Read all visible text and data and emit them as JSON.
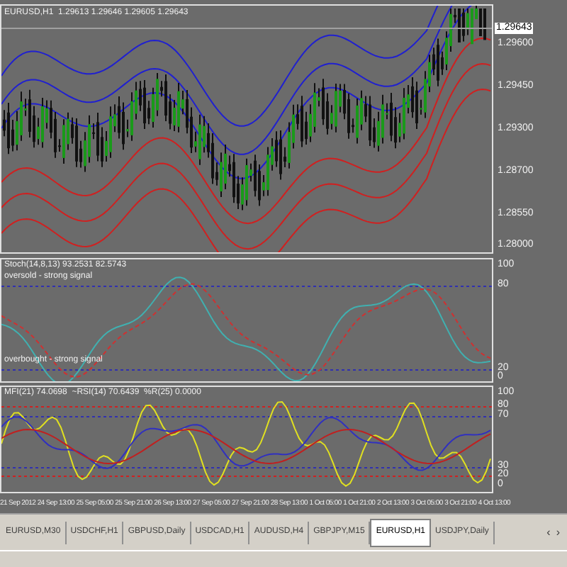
{
  "main_chart": {
    "title": "EURUSD,H1  1.29613 1.29646 1.29605 1.29643",
    "price_tag": "1.29643",
    "price_axis": [
      "1.29600",
      "1.29450",
      "1.29300",
      "1.28700",
      "1.28550",
      "1.28000"
    ]
  },
  "stoch_panel": {
    "title": "Stoch(14,8,13) 93.2531 82.5743",
    "upper_label": "oversold - strong signal",
    "lower_label": "overbought - strong signal",
    "axis": [
      "100",
      "80",
      "20",
      "0"
    ]
  },
  "mfi_panel": {
    "title": "MFI(21) 74.0698  ~RSI(14) 70.6439  %R(25) 0.0000",
    "axis": [
      "100",
      "80",
      "70",
      "30",
      "20",
      "0"
    ]
  },
  "time_axis": [
    "21 Sep 2012",
    "24 Sep 13:00",
    "25 Sep 05:00",
    "25 Sep 21:00",
    "26 Sep 13:00",
    "27 Sep 05:00",
    "27 Sep 21:00",
    "28 Sep 13:00",
    "1 Oct 05:00",
    "1 Oct 21:00",
    "2 Oct 13:00",
    "3 Oct 05:00",
    "3 Oct 21:00",
    "4 Oct 13:00"
  ],
  "tabs": [
    {
      "label": "EURUSD,M30",
      "selected": false
    },
    {
      "label": "USDCHF,H1",
      "selected": false
    },
    {
      "label": "GBPUSD,Daily",
      "selected": false
    },
    {
      "label": "USDCAD,H1",
      "selected": false
    },
    {
      "label": "AUDUSD,H4",
      "selected": false
    },
    {
      "label": "GBPJPY,M15",
      "selected": false
    },
    {
      "label": "EURUSD,H1",
      "selected": true
    },
    {
      "label": "USDJPY,Daily",
      "selected": false
    }
  ],
  "tab_scroll": [
    "‹",
    "›"
  ]
}
